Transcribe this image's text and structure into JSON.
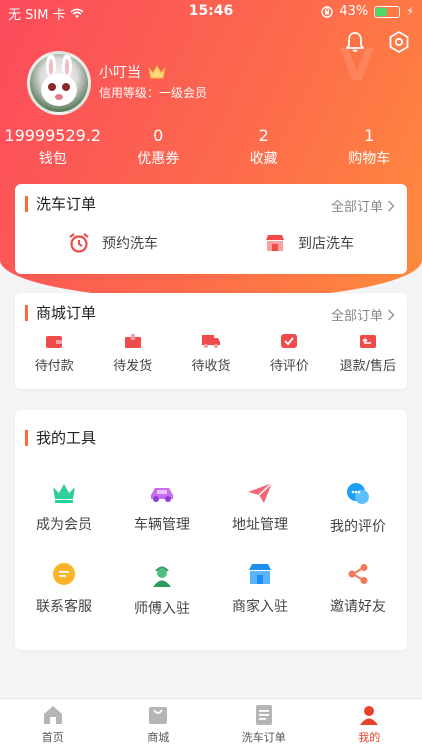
{
  "status_bar": {
    "carrier": "无 SIM 卡",
    "time": "15:46",
    "battery": "43%"
  },
  "profile": {
    "name": "小叮当",
    "credit": "信用等级：一级会员"
  },
  "stats": [
    {
      "value": "19999529.2",
      "label": "钱包"
    },
    {
      "value": "0",
      "label": "优惠券"
    },
    {
      "value": "2",
      "label": "收藏"
    },
    {
      "value": "1",
      "label": "购物车"
    }
  ],
  "wash_orders": {
    "title": "洗车订单",
    "more": "全部订单",
    "items": [
      {
        "label": "预约洗车",
        "icon": "alarm-clock-icon"
      },
      {
        "label": "到店洗车",
        "icon": "store-icon"
      }
    ]
  },
  "mall_orders": {
    "title": "商城订单",
    "more": "全部订单",
    "items": [
      {
        "label": "待付款",
        "icon": "wallet-icon"
      },
      {
        "label": "待发货",
        "icon": "package-icon"
      },
      {
        "label": "待收货",
        "icon": "truck-icon"
      },
      {
        "label": "待评价",
        "icon": "review-icon"
      },
      {
        "label": "退款/售后",
        "icon": "refund-icon"
      }
    ]
  },
  "tools": {
    "title": "我的工具",
    "items": [
      {
        "label": "成为会员",
        "icon": "crown-icon"
      },
      {
        "label": "车辆管理",
        "icon": "car-icon"
      },
      {
        "label": "地址管理",
        "icon": "paper-plane-icon"
      },
      {
        "label": "我的评价",
        "icon": "chat-bubbles-icon"
      },
      {
        "label": "联系客服",
        "icon": "message-icon"
      },
      {
        "label": "师傅入驻",
        "icon": "worker-icon"
      },
      {
        "label": "商家入驻",
        "icon": "shop-icon"
      },
      {
        "label": "邀请好友",
        "icon": "share-icon"
      }
    ]
  },
  "tabbar": [
    {
      "label": "首页",
      "icon": "home-icon"
    },
    {
      "label": "商城",
      "icon": "bag-icon"
    },
    {
      "label": "洗车订单",
      "icon": "document-icon"
    },
    {
      "label": "我的",
      "icon": "user-icon"
    }
  ],
  "colors": {
    "hero_start": "#fb4a5c",
    "hero_end": "#fe8c3c",
    "accent": "#fd6a3c",
    "tab_active": "#e8412a"
  }
}
